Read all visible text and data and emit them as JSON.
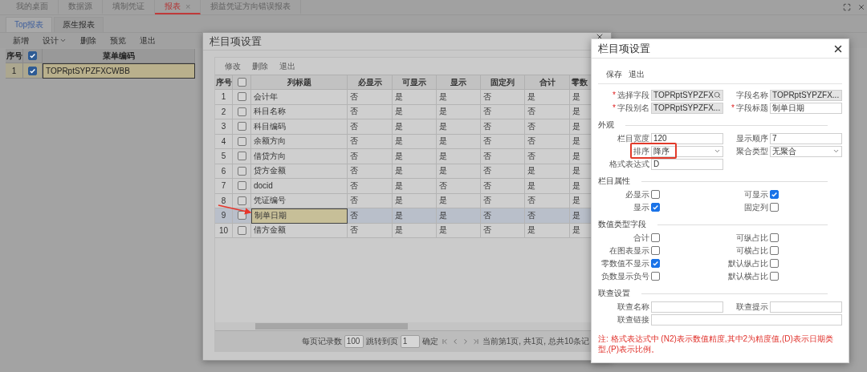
{
  "app": {
    "tabs": [
      {
        "label": "我的桌面",
        "selected": false
      },
      {
        "label": "数据源",
        "selected": false
      },
      {
        "label": "填制凭证",
        "selected": false
      },
      {
        "label": "报表",
        "selected": true,
        "close": "×"
      },
      {
        "label": "损益凭证方向错误报表",
        "selected": false
      }
    ],
    "sub_tabs": [
      {
        "label": "Top报表",
        "selected": true
      },
      {
        "label": "原生报表",
        "selected": false
      }
    ],
    "toolbar": [
      {
        "label": "新增",
        "kind": "button"
      },
      {
        "label": "设计",
        "kind": "dropdown"
      },
      {
        "label": "删除",
        "kind": "button"
      },
      {
        "label": "预览",
        "kind": "button"
      },
      {
        "label": "退出",
        "kind": "button"
      }
    ],
    "table": {
      "all_checked": true,
      "columns": [
        "序号",
        "菜单编码"
      ],
      "rows": [
        {
          "index": "1",
          "checked": true,
          "selected": true,
          "code": "TOPRptSYPZFXCWBB"
        }
      ]
    }
  },
  "column_dialog": {
    "title": "栏目项设置",
    "toolbar": [
      "修改",
      "删除",
      "退出"
    ],
    "table": {
      "all_checked": false,
      "columns": [
        "序号",
        "列标题",
        "必显示",
        "可显示",
        "显示",
        "固定列",
        "合计",
        "零数"
      ],
      "rows": [
        {
          "index": "1",
          "checked": false,
          "selected": false,
          "title": "会计年",
          "values": [
            "否",
            "是",
            "是",
            "否",
            "是",
            "是"
          ]
        },
        {
          "index": "2",
          "checked": false,
          "selected": false,
          "title": "科目名称",
          "values": [
            "否",
            "是",
            "是",
            "否",
            "否",
            "是"
          ]
        },
        {
          "index": "3",
          "checked": false,
          "selected": false,
          "title": "科目编码",
          "values": [
            "否",
            "是",
            "是",
            "否",
            "否",
            "是"
          ]
        },
        {
          "index": "4",
          "checked": false,
          "selected": false,
          "title": "余额方向",
          "values": [
            "否",
            "是",
            "是",
            "否",
            "否",
            "是"
          ]
        },
        {
          "index": "5",
          "checked": false,
          "selected": false,
          "title": "借贷方向",
          "values": [
            "否",
            "是",
            "是",
            "否",
            "否",
            "是"
          ]
        },
        {
          "index": "6",
          "checked": false,
          "selected": false,
          "title": "贷方金额",
          "values": [
            "否",
            "是",
            "是",
            "否",
            "是",
            "是"
          ]
        },
        {
          "index": "7",
          "checked": false,
          "selected": false,
          "title": "docid",
          "values": [
            "否",
            "是",
            "否",
            "否",
            "是",
            "是"
          ]
        },
        {
          "index": "8",
          "checked": false,
          "selected": false,
          "title": "凭证编号",
          "values": [
            "否",
            "是",
            "是",
            "否",
            "否",
            "是"
          ]
        },
        {
          "index": "9",
          "checked": false,
          "selected": true,
          "title": "制单日期",
          "values": [
            "否",
            "是",
            "是",
            "否",
            "否",
            "是"
          ]
        },
        {
          "index": "10",
          "checked": false,
          "selected": false,
          "title": "借方金额",
          "values": [
            "否",
            "是",
            "是",
            "否",
            "是",
            "是"
          ]
        }
      ]
    },
    "pagination": {
      "page_size_label": "每页记录数",
      "page_size": "100",
      "jump_label": "跳转到页",
      "page": "1",
      "confirm": "确定",
      "status": "当前第1页, 共1页, 总共10条记"
    }
  },
  "edit_dialog": {
    "title": "栏目项设置",
    "toolbar": [
      "保存",
      "退出"
    ],
    "fields": [
      {
        "kind": "lookup",
        "mark": "*",
        "label": "选择字段",
        "value": "TOPRptSYPZFX"
      },
      {
        "kind": "readonly",
        "label": "字段名称",
        "value": "TOPRptSYPZFX..."
      },
      {
        "kind": "readonly",
        "mark": "*",
        "label": "字段别名",
        "value": "TOPRptSYPZFX..."
      },
      {
        "kind": "text",
        "mark": "*",
        "label": "字段标题",
        "value": "制单日期"
      }
    ],
    "sections": [
      {
        "title": "外观",
        "items": [
          {
            "kind": "text",
            "label": "栏目宽度",
            "value": "120"
          },
          {
            "kind": "text",
            "label": "显示顺序",
            "value": "7"
          },
          {
            "kind": "select",
            "label": "排序",
            "value": "降序",
            "annotated": true
          },
          {
            "kind": "select",
            "label": "聚合类型",
            "value": "无聚合",
            "annotated": false
          },
          {
            "kind": "text",
            "label": "格式表达式",
            "value": "D"
          }
        ]
      },
      {
        "title": "栏目属性",
        "items": [
          {
            "kind": "checkbox",
            "label": "必显示",
            "checked": false
          },
          {
            "kind": "checkbox",
            "label": "可显示",
            "checked": true
          },
          {
            "kind": "checkbox",
            "label": "显示",
            "checked": true
          },
          {
            "kind": "checkbox",
            "label": "固定列",
            "checked": false
          }
        ]
      },
      {
        "title": "数值类型字段",
        "items": [
          {
            "kind": "checkbox",
            "label": "合计",
            "checked": false
          },
          {
            "kind": "checkbox",
            "label": "可纵占比",
            "checked": false
          },
          {
            "kind": "checkbox",
            "label": "在图表显示",
            "checked": false
          },
          {
            "kind": "checkbox",
            "label": "可横占比",
            "checked": false
          },
          {
            "kind": "checkbox",
            "label": "零数值不显示",
            "checked": true
          },
          {
            "kind": "checkbox",
            "label": "默认纵占比",
            "checked": false
          },
          {
            "kind": "checkbox",
            "label": "负数显示负号",
            "checked": false
          },
          {
            "kind": "checkbox",
            "label": "默认横占比",
            "checked": false
          }
        ]
      },
      {
        "title": "联查设置",
        "items": [
          {
            "kind": "text",
            "label": "联查名称"
          },
          {
            "kind": "text",
            "label": "联查提示"
          },
          {
            "kind": "wide",
            "label": "联查链接"
          }
        ]
      }
    ],
    "note": "注: 格式表达式中 (N2)表示数值精度,其中2为精度值,(D)表示日期类型,(P)表示比例。"
  }
}
